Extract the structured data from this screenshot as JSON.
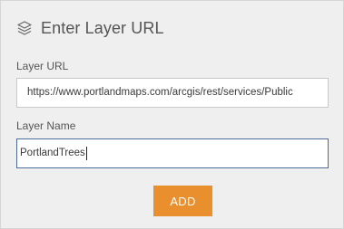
{
  "panel": {
    "title": "Enter Layer URL",
    "title_icon": "layers-icon"
  },
  "form": {
    "url_label": "Layer URL",
    "url_value": "https://www.portlandmaps.com/arcgis/rest/services/Public",
    "name_label": "Layer Name",
    "name_value": "PortlandTrees",
    "add_label": "ADD"
  },
  "colors": {
    "panel_bg": "#efefef",
    "accent": "#ea8f2e",
    "focus_border": "#4d6d99",
    "text": "#555555"
  }
}
